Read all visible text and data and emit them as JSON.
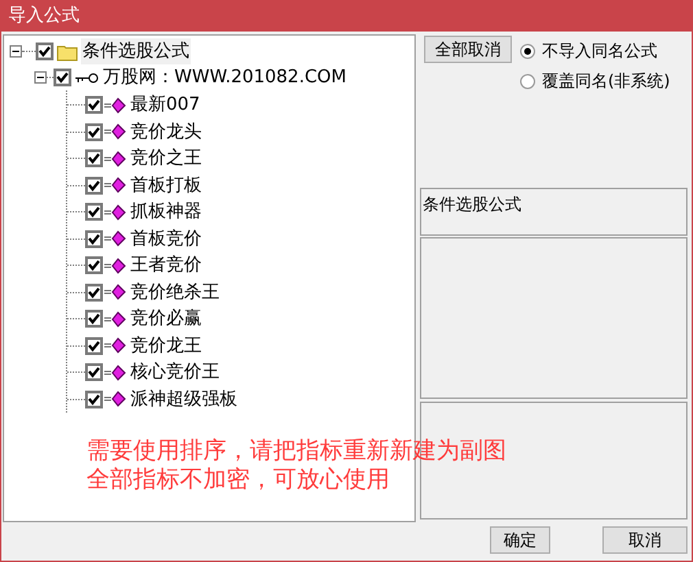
{
  "window": {
    "title": "导入公式"
  },
  "tree": {
    "label": "条件选股公式",
    "checked": true,
    "expanded": true,
    "children": [
      {
        "label": "万股网：WWW.201082.COM",
        "checked": true,
        "expanded": true,
        "children": [
          {
            "label": "最新007",
            "checked": true
          },
          {
            "label": "竞价龙头",
            "checked": true
          },
          {
            "label": "竞价之王",
            "checked": true
          },
          {
            "label": "首板打板",
            "checked": true
          },
          {
            "label": "抓板神器",
            "checked": true
          },
          {
            "label": "首板竞价",
            "checked": true
          },
          {
            "label": "王者竞价",
            "checked": true
          },
          {
            "label": "竞价绝杀王",
            "checked": true
          },
          {
            "label": "竞价必赢",
            "checked": true
          },
          {
            "label": "竞价龙王",
            "checked": true
          },
          {
            "label": "核心竞价王",
            "checked": true
          },
          {
            "label": "派神超级强板",
            "checked": true
          }
        ]
      }
    ]
  },
  "deselect_all_button": "全部取消",
  "options": [
    {
      "label": "不导入同名公式",
      "selected": true
    },
    {
      "label": "覆盖同名(非系统)",
      "selected": false
    }
  ],
  "info_panel": {
    "title": "条件选股公式"
  },
  "note": [
    "需要使用排序，请把指标重新新建为副图",
    "全部指标不加密，可放心使用"
  ],
  "buttons": [
    "确定",
    "取消"
  ]
}
